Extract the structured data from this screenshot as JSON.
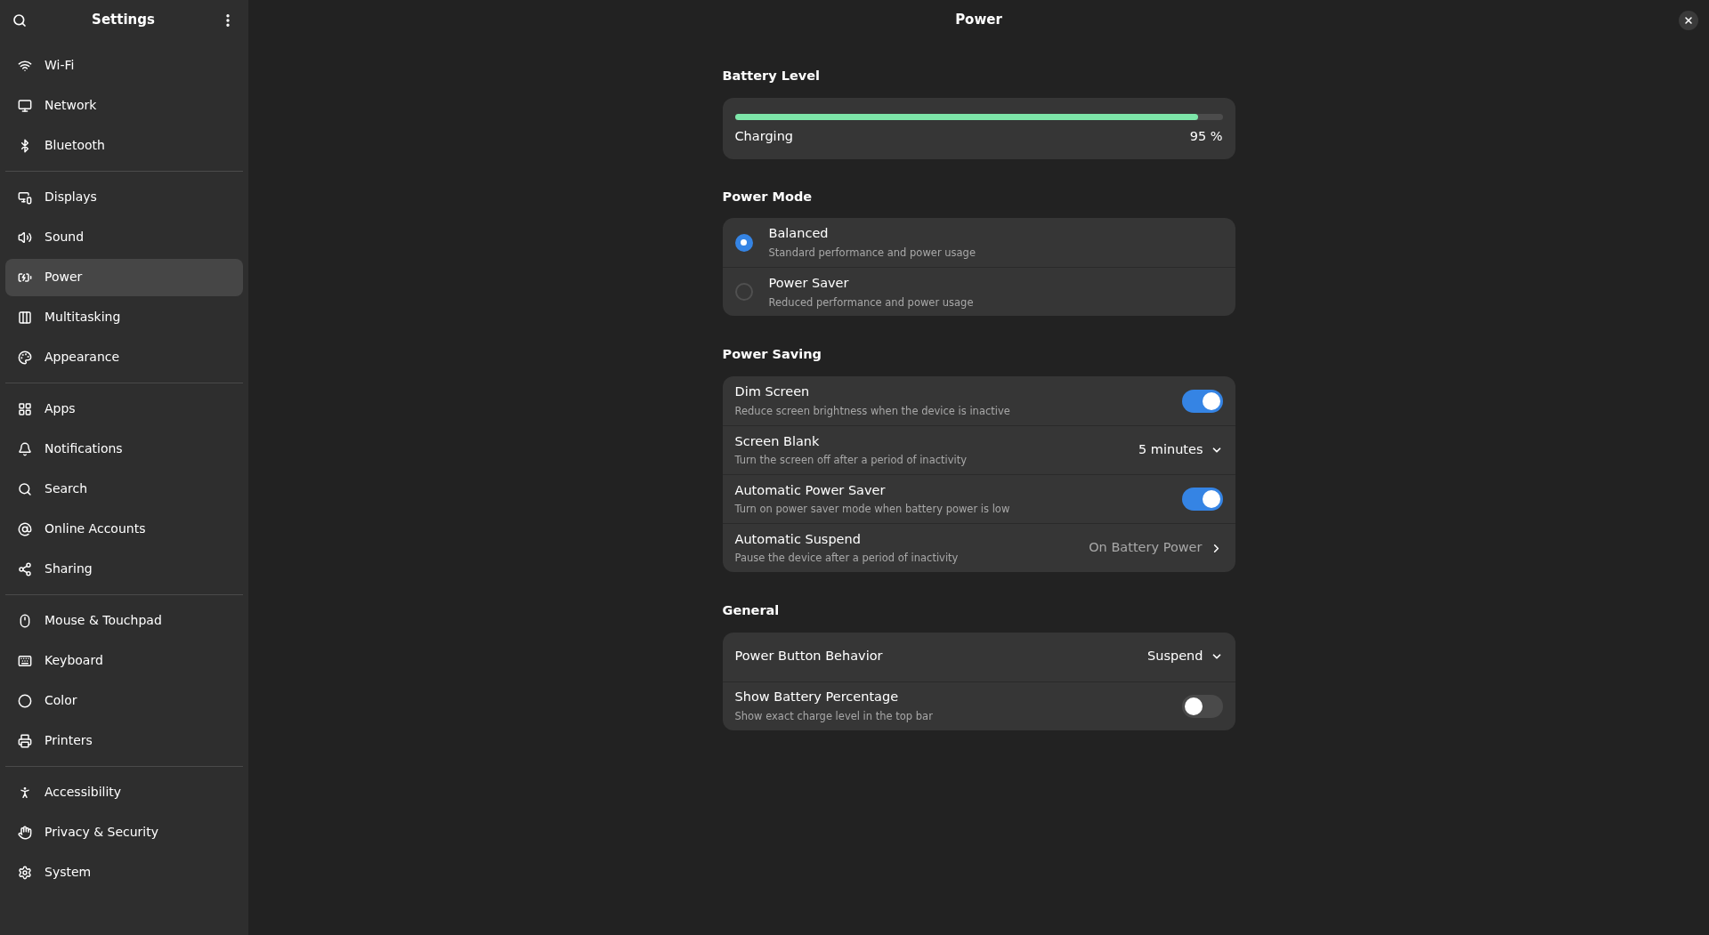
{
  "sidebar": {
    "title": "Settings",
    "groups": [
      [
        {
          "label": "Wi-Fi",
          "kind": "wifi",
          "selected": false
        },
        {
          "label": "Network",
          "kind": "network",
          "selected": false
        },
        {
          "label": "Bluetooth",
          "kind": "bluetooth",
          "selected": false
        }
      ],
      [
        {
          "label": "Displays",
          "kind": "displays",
          "selected": false
        },
        {
          "label": "Sound",
          "kind": "sound",
          "selected": false
        },
        {
          "label": "Power",
          "kind": "power",
          "selected": true
        },
        {
          "label": "Multitasking",
          "kind": "multitasking",
          "selected": false
        },
        {
          "label": "Appearance",
          "kind": "appearance",
          "selected": false
        }
      ],
      [
        {
          "label": "Apps",
          "kind": "apps",
          "selected": false
        },
        {
          "label": "Notifications",
          "kind": "notifications",
          "selected": false
        },
        {
          "label": "Search",
          "kind": "search",
          "selected": false
        },
        {
          "label": "Online Accounts",
          "kind": "accounts",
          "selected": false
        },
        {
          "label": "Sharing",
          "kind": "sharing",
          "selected": false
        }
      ],
      [
        {
          "label": "Mouse & Touchpad",
          "kind": "mouse",
          "selected": false
        },
        {
          "label": "Keyboard",
          "kind": "keyboard",
          "selected": false
        },
        {
          "label": "Color",
          "kind": "color",
          "selected": false
        },
        {
          "label": "Printers",
          "kind": "printers",
          "selected": false
        }
      ],
      [
        {
          "label": "Accessibility",
          "kind": "accessibility",
          "selected": false
        },
        {
          "label": "Privacy & Security",
          "kind": "privacy",
          "selected": false
        },
        {
          "label": "System",
          "kind": "system",
          "selected": false
        }
      ]
    ]
  },
  "page": {
    "title": "Power"
  },
  "battery": {
    "heading": "Battery Level",
    "level": 0.95,
    "status": "Charging",
    "reading": "95 %"
  },
  "power_mode": {
    "heading": "Power Mode",
    "options": [
      {
        "title": "Balanced",
        "subtitle": "Standard performance and power usage",
        "selected": true
      },
      {
        "title": "Power Saver",
        "subtitle": "Reduced performance and power usage",
        "selected": false
      }
    ]
  },
  "sections": [
    {
      "heading": "Power Saving",
      "rows": [
        {
          "kind": "toggle",
          "title": "Dim Screen",
          "subtitle": "Reduce screen brightness when the device is inactive",
          "on": true
        },
        {
          "kind": "dropdown",
          "title": "Screen Blank",
          "subtitle": "Turn the screen off after a period of inactivity",
          "value": "5 minutes"
        },
        {
          "kind": "toggle",
          "title": "Automatic Power Saver",
          "subtitle": "Turn on power saver mode when battery power is low",
          "on": true
        },
        {
          "kind": "link",
          "title": "Automatic Suspend",
          "subtitle": "Pause the device after a period of inactivity",
          "value": "On Battery Power"
        }
      ]
    },
    {
      "heading": "General",
      "rows": [
        {
          "kind": "dropdown",
          "title": "Power Button Behavior",
          "value": "Suspend"
        },
        {
          "kind": "toggle",
          "title": "Show Battery Percentage",
          "subtitle": "Show exact charge level in the top bar",
          "on": false
        }
      ]
    }
  ]
}
